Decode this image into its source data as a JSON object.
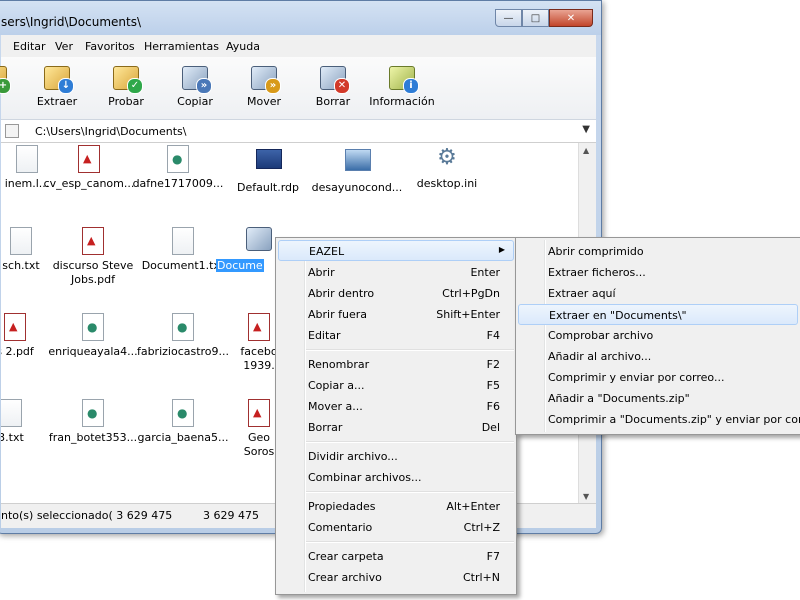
{
  "window": {
    "title": "sers\\Ingrid\\Documents\\",
    "controls": {
      "minimize": "—",
      "maximize": "□",
      "close": "✕"
    }
  },
  "menubar": [
    "Editar",
    "Ver",
    "Favoritos",
    "Herramientas",
    "Ayuda"
  ],
  "toolbar": [
    {
      "label": "ar",
      "icon": "add-archive-icon",
      "badge": "+"
    },
    {
      "label": "Extraer",
      "icon": "extract-icon",
      "badge": "↓"
    },
    {
      "label": "Probar",
      "icon": "test-icon",
      "badge": "✓"
    },
    {
      "label": "Copiar",
      "icon": "copy-icon",
      "badge": "»"
    },
    {
      "label": "Mover",
      "icon": "move-icon",
      "badge": "»"
    },
    {
      "label": "Borrar",
      "icon": "delete-icon",
      "badge": "✕"
    },
    {
      "label": "Información",
      "icon": "info-icon",
      "badge": "i"
    }
  ],
  "address": {
    "path": "C:\\Users\\Ingrid\\Documents\\"
  },
  "files": [
    {
      "name": "inem.l...",
      "type": "txt"
    },
    {
      "name": "cv_esp_canom...",
      "type": "pdf"
    },
    {
      "name": "dafne1717009...",
      "type": "web"
    },
    {
      "name": "Default.rdp",
      "type": "rdp"
    },
    {
      "name": "desayunocond...",
      "type": "img"
    },
    {
      "name": "desktop.ini",
      "type": "gear"
    },
    {
      "name": "sch.txt",
      "type": "txt"
    },
    {
      "name": "discurso Steve Jobs.pdf",
      "type": "pdf"
    },
    {
      "name": "Document1.txt",
      "type": "txt"
    },
    {
      "name": "Docume",
      "type": "zip"
    },
    {
      "name": "s 2.pdf",
      "type": "pdf"
    },
    {
      "name": "enriqueayala4...",
      "type": "web"
    },
    {
      "name": "fabriziocastro9...",
      "type": "web"
    },
    {
      "name": "facebo 1939.",
      "type": "pdf"
    },
    {
      "name": "3.txt",
      "type": "txt"
    },
    {
      "name": "fran_botet353...",
      "type": "web"
    },
    {
      "name": "garcia_baena5...",
      "type": "web"
    },
    {
      "name": "Geo Soros",
      "type": "pdf"
    }
  ],
  "status": {
    "selected": "nto(s) seleccionado( 3 629 475",
    "size": "3 629 475"
  },
  "context_menu": [
    {
      "label": "EAZEL",
      "shortcut": "",
      "submenu": true,
      "highlight": true
    },
    {
      "label": "Abrir",
      "shortcut": "Enter"
    },
    {
      "label": "Abrir dentro",
      "shortcut": "Ctrl+PgDn"
    },
    {
      "label": "Abrir fuera",
      "shortcut": "Shift+Enter"
    },
    {
      "label": "Editar",
      "shortcut": "F4"
    },
    {
      "label": "Renombrar",
      "shortcut": "F2"
    },
    {
      "label": "Copiar a...",
      "shortcut": "F5"
    },
    {
      "label": "Mover a...",
      "shortcut": "F6"
    },
    {
      "label": "Borrar",
      "shortcut": "Del"
    },
    {
      "label": "Dividir archivo...",
      "shortcut": ""
    },
    {
      "label": "Combinar archivos...",
      "shortcut": ""
    },
    {
      "label": "Propiedades",
      "shortcut": "Alt+Enter"
    },
    {
      "label": "Comentario",
      "shortcut": "Ctrl+Z"
    },
    {
      "label": "Crear carpeta",
      "shortcut": "F7"
    },
    {
      "label": "Crear archivo",
      "shortcut": "Ctrl+N"
    }
  ],
  "submenu": [
    {
      "label": "Abrir comprimido"
    },
    {
      "label": "Extraer ficheros..."
    },
    {
      "label": "Extraer aquí"
    },
    {
      "label": "Extraer en \"Documents\\\"",
      "highlight": true
    },
    {
      "label": "Comprobar archivo"
    },
    {
      "label": "Añadir al archivo..."
    },
    {
      "label": "Comprimir y enviar por correo..."
    },
    {
      "label": "Añadir a \"Documents.zip\""
    },
    {
      "label": "Comprimir a \"Documents.zip\" y enviar por correo"
    }
  ]
}
